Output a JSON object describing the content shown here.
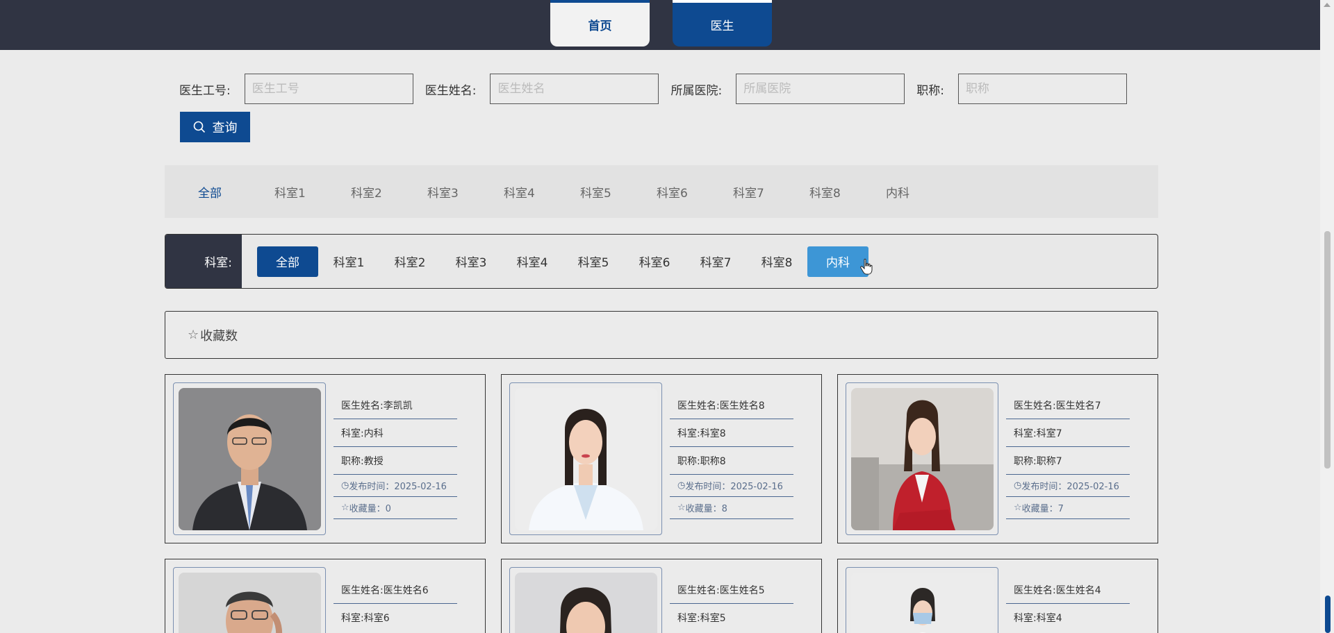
{
  "nav": {
    "home_label": "首页",
    "doctor_label": "医生"
  },
  "search": {
    "fields": [
      {
        "label": "医生工号:",
        "placeholder": "医生工号"
      },
      {
        "label": "医生姓名:",
        "placeholder": "医生姓名"
      },
      {
        "label": "所属医院:",
        "placeholder": "所属医院"
      },
      {
        "label": "职称:",
        "placeholder": "职称"
      }
    ],
    "query_label": "查询"
  },
  "category_bar": {
    "items": [
      "全部",
      "科室1",
      "科室2",
      "科室3",
      "科室4",
      "科室5",
      "科室6",
      "科室7",
      "科室8",
      "内科"
    ],
    "active_index": 0
  },
  "filter_bar": {
    "label": "科室:",
    "items": [
      "全部",
      "科室1",
      "科室2",
      "科室3",
      "科室4",
      "科室5",
      "科室6",
      "科室7",
      "科室8",
      "内科"
    ],
    "selected_index": 0,
    "hover_index": 9
  },
  "sort": {
    "label": "收藏数"
  },
  "colors": {
    "primary": "#0e4a91",
    "header_bg": "#303443",
    "hover": "#3d96d6",
    "page_bg": "#ebebeb"
  },
  "doctors": [
    {
      "name": "医生姓名:李凯凯",
      "dept": "科室:内科",
      "title": "职称:教授",
      "date": "发布时间：2025-02-16",
      "fav": "收藏量：0"
    },
    {
      "name": "医生姓名:医生姓名8",
      "dept": "科室:科室8",
      "title": "职称:职称8",
      "date": "发布时间：2025-02-16",
      "fav": "收藏量：8"
    },
    {
      "name": "医生姓名:医生姓名7",
      "dept": "科室:科室7",
      "title": "职称:职称7",
      "date": "发布时间：2025-02-16",
      "fav": "收藏量：7"
    },
    {
      "name": "医生姓名:医生姓名6",
      "dept": "科室:科室6"
    },
    {
      "name": "医生姓名:医生姓名5",
      "dept": "科室:科室5"
    },
    {
      "name": "医生姓名:医生姓名4",
      "dept": "科室:科室4"
    }
  ]
}
